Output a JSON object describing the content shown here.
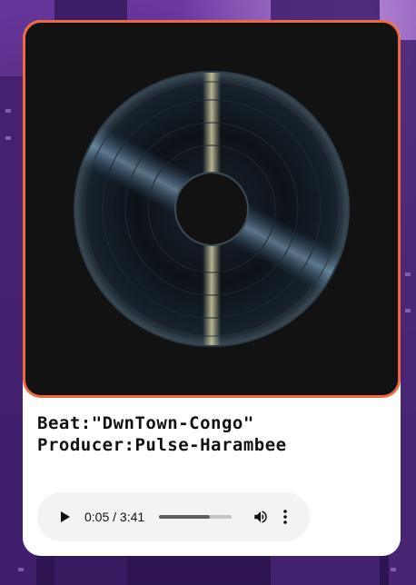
{
  "track": {
    "beat_label": "Beat:",
    "beat_title": "\"DwnTown-Congo\"",
    "producer_label": "Producer:",
    "producer_name": "Pulse-Harambee"
  },
  "player": {
    "current_time": "0:05",
    "separator": " / ",
    "duration": "3:41",
    "progress_fraction": 0.7,
    "play_icon": "play-icon",
    "volume_icon": "volume-icon",
    "more_icon": "more-vert-icon"
  },
  "colors": {
    "accent_border": "#ef6a3a",
    "card_bg": "#ffffff",
    "art_bg": "#121212",
    "player_bg": "#f1f3f4"
  }
}
